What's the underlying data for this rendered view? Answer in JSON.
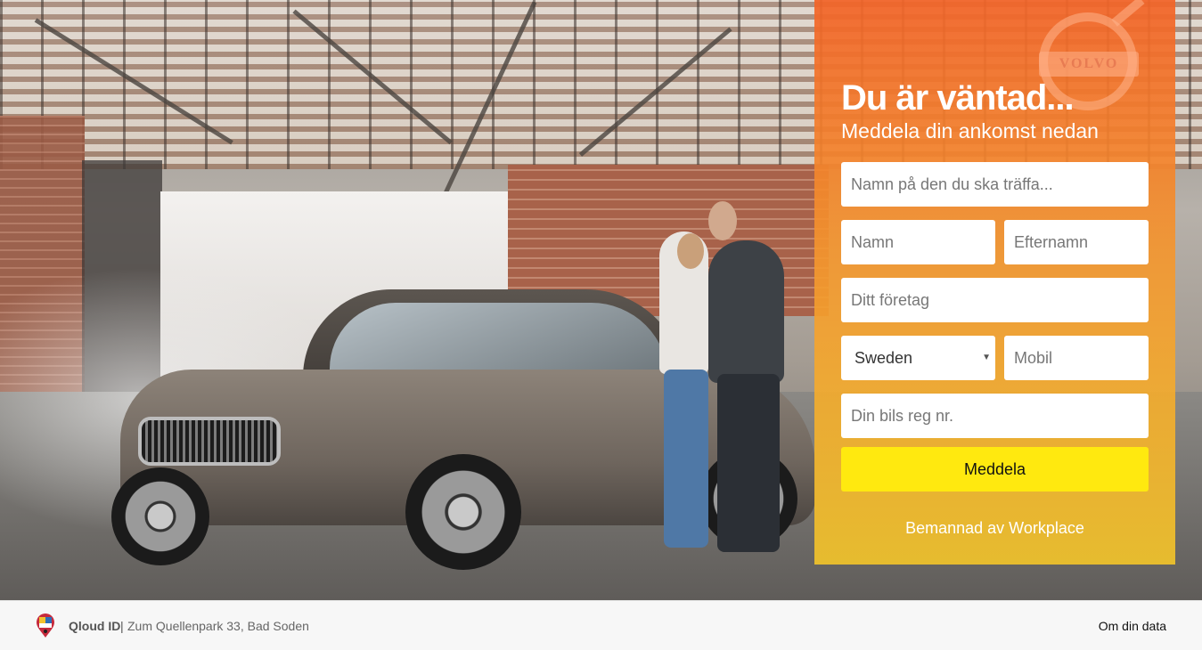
{
  "brand": {
    "logo_text": "VOLVO"
  },
  "panel": {
    "title": "Du är väntad...",
    "subtitle": "Meddela din ankomst nedan",
    "host_placeholder": "Namn på den du ska träffa...",
    "first_name_placeholder": "Namn",
    "last_name_placeholder": "Efternamn",
    "company_placeholder": "Ditt företag",
    "country_selected": "Sweden",
    "mobile_placeholder": "Mobil",
    "reg_placeholder": "Din bils reg nr.",
    "submit_label": "Meddela",
    "staffed_by": "Bemannad av Workplace"
  },
  "footer": {
    "brand": "Qloud ID",
    "separator": "|",
    "address": "Zum Quellenpark 33, Bad Soden",
    "data_link": "Om din data"
  },
  "colors": {
    "panel_top": "#f26428",
    "panel_bottom": "#f8c828",
    "submit_bg": "#ffe90f"
  }
}
